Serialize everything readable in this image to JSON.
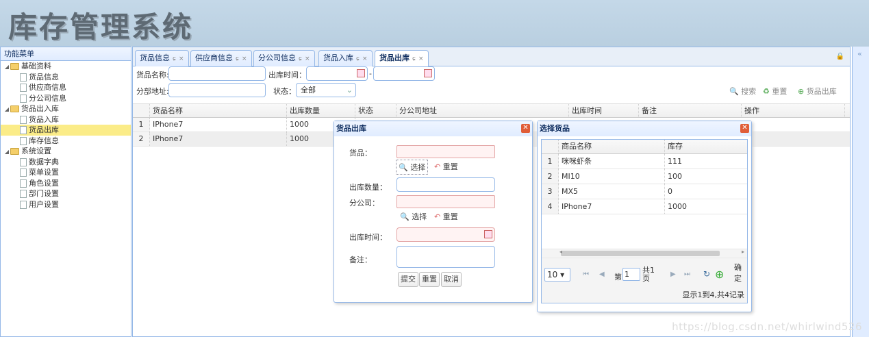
{
  "app": {
    "title": "库存管理系统"
  },
  "west": {
    "title": "功能菜单",
    "items": [
      {
        "label": "基础资料",
        "kind": "folder"
      },
      {
        "label": "货品信息",
        "kind": "file"
      },
      {
        "label": "供应商信息",
        "kind": "file"
      },
      {
        "label": "分公司信息",
        "kind": "file"
      },
      {
        "label": "货品出入库",
        "kind": "folder"
      },
      {
        "label": "货品入库",
        "kind": "file"
      },
      {
        "label": "货品出库",
        "kind": "file"
      },
      {
        "label": "库存信息",
        "kind": "file"
      },
      {
        "label": "系统设置",
        "kind": "folder"
      },
      {
        "label": "数据字典",
        "kind": "file"
      },
      {
        "label": "菜单设置",
        "kind": "file"
      },
      {
        "label": "角色设置",
        "kind": "file"
      },
      {
        "label": "部门设置",
        "kind": "file"
      },
      {
        "label": "用户设置",
        "kind": "file"
      }
    ]
  },
  "tabs": [
    "货品信息",
    "供应商信息",
    "分公司信息",
    "货品入库",
    "货品出库"
  ],
  "tab_glyphs": {
    "refresh": "ɕ",
    "close": "×"
  },
  "search": {
    "name_label": "货品名称:",
    "time_label": "出库时间：",
    "dash": "-",
    "addr_label": "分部地址:",
    "status_label": "状态：",
    "status_value": "全部",
    "search_btn": "搜索",
    "reset_btn": "重置",
    "out_btn": "货品出库"
  },
  "grid": {
    "headers": [
      "货品名称",
      "出库数量",
      "状态",
      "分公司地址",
      "出库时间",
      "备注",
      "操作"
    ],
    "rows": [
      {
        "n": "1",
        "name": "IPhone7",
        "qty": "1000"
      },
      {
        "n": "2",
        "name": "IPhone7",
        "qty": "1000"
      }
    ]
  },
  "dlg1": {
    "title": "货品出库",
    "goods_label": "货品：",
    "choose": "选择",
    "reset": "重置",
    "qty_label": "出库数量：",
    "branch_label": "分公司：",
    "time_label": "出库时间：",
    "note_label": "备注：",
    "submit": "提交",
    "reset2": "重置",
    "cancel": "取消"
  },
  "dlg2": {
    "title": "选择货品",
    "headers": [
      "商品名称",
      "库存"
    ],
    "rows": [
      {
        "n": "1",
        "name": "咪咪虾条",
        "stock": "111"
      },
      {
        "n": "2",
        "name": "MI10",
        "stock": "100"
      },
      {
        "n": "3",
        "name": "MX5",
        "stock": "0"
      },
      {
        "n": "4",
        "name": "IPhone7",
        "stock": "1000"
      }
    ],
    "page_size": "10",
    "page_prefix": "第",
    "page_value": "1",
    "page_total_a": "共1",
    "page_total_b": "页",
    "confirm_a": "确",
    "confirm_b": "定",
    "summary": "显示1到4,共4记录"
  },
  "watermark": "https://blog.csdn.net/whirlwind526",
  "collapse": "«"
}
